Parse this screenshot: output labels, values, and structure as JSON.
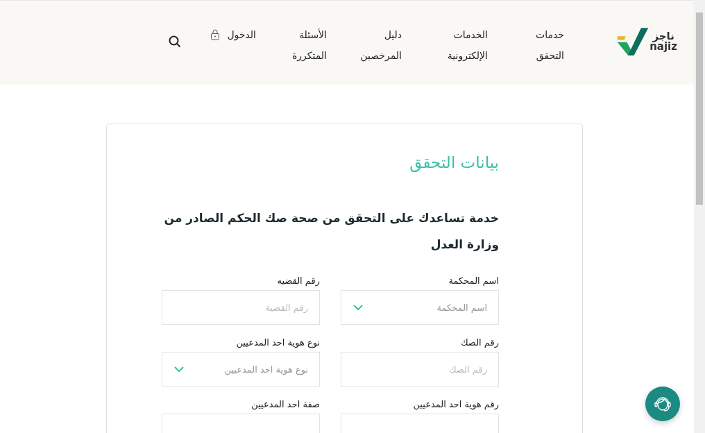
{
  "logo": {
    "arabic": "ناجز",
    "latin": "najiz"
  },
  "nav": [
    {
      "label": "خدمات التحقق"
    },
    {
      "label": "الخدمات الإلكترونية"
    },
    {
      "label": "دليل المرخصين"
    },
    {
      "label": "الأسئلة المتكررة"
    }
  ],
  "login": {
    "label": "الدخول"
  },
  "card": {
    "title": "بيانات التحقق",
    "description": "خدمة تساعدك على التحقق من صحة صك الحكم الصادر من وزارة العدل",
    "fields": [
      {
        "label": "اسم المحكمة",
        "kind": "select",
        "placeholder": "اسم المحكمة"
      },
      {
        "label": "رقم القضيه",
        "kind": "text",
        "placeholder": "رقم القضية"
      },
      {
        "label": "رقم الصك",
        "kind": "text",
        "placeholder": "رقم الصك"
      },
      {
        "label": "نوع هوية احد المدعيين",
        "kind": "select",
        "placeholder": "نوع هوية احد المدعيين"
      },
      {
        "label": "رقم هوية احد المدعيين",
        "kind": "text"
      },
      {
        "label": "صفة احد المدعيين",
        "kind": "text"
      }
    ]
  }
}
